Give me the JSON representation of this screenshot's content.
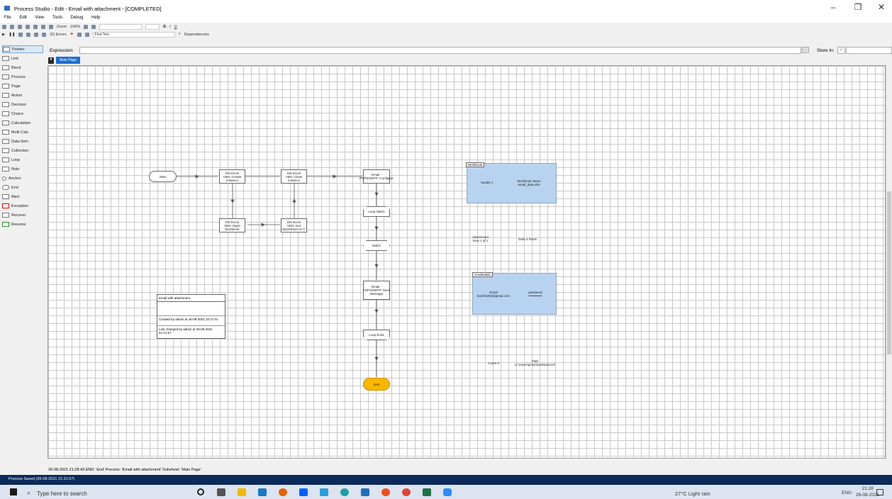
{
  "window": {
    "title": "Process Studio - Edit - Email with attachment - [COMPLETED]"
  },
  "menu": [
    "File",
    "Edit",
    "View",
    "Tools",
    "Debug",
    "Help"
  ],
  "toolbar1": {
    "zoom_label": "Zoom",
    "zoom_value": "100%"
  },
  "toolbar2": {
    "errors": "(0) Errors",
    "find_text": "Find Text",
    "dependencies": "Dependencies"
  },
  "expression": {
    "label": "Expression:",
    "store_in_label": "Store In:"
  },
  "tabs": {
    "main": "Main Page"
  },
  "tools": [
    "Pointer",
    "Link",
    "Block",
    "Process",
    "Page",
    "Action",
    "Decision",
    "Choice",
    "Calculation",
    "Multi Calc",
    "Data Item",
    "Collection",
    "Loop",
    "Note",
    "Anchor",
    "End",
    "Alert",
    "Exception",
    "Recover",
    "Resume"
  ],
  "flow": {
    "start": "Start",
    "create": "MS Excel VBO::Create Instance",
    "open": "MS Excel VBO::Open Workbook",
    "get": "MS Excel VBO::Get Worksheet As C",
    "close": "MS Excel VBO::Close Instance",
    "config": "Email - POP3/SMTP::Configure",
    "loop_start": "Loop Start1",
    "multi": "Multi1",
    "send": "Email - POP3/SMTP::Send Message",
    "loop_end": "Loop End1",
    "end": "End"
  },
  "info": {
    "title": "Email with attachment",
    "created": "Created by admin at 26-08-2021 10:27:01",
    "changed": "Last changed by admin at 26-08-2021 21:21:57"
  },
  "data": {
    "workbook_group": "Workbook",
    "handle": "handle 1",
    "wbname": "Workbook Name email_data.xlsx",
    "attachment": "Attachment Row 1 of 1",
    "dataitem": "Data 4 Rows",
    "cred_group": "Credentials",
    "email": "Email learnfs300@gmail.com",
    "password": "password ••••••••••••",
    "count": "Count 3",
    "path": "Path C:\\Users\\pinky\\Desktop\\cert\\"
  },
  "status": {
    "message": "26-08-2021 21:28:43 END: 'End' Process: 'Email with attachment' Subsheet: 'Main Page'",
    "saved": "Process Saved (26-08-2021 21:21:57)"
  },
  "taskbar": {
    "search": "Type here to search",
    "weather": "27°C  Light rain",
    "lang": "ENG",
    "time": "21:28",
    "date": "26-08-2021"
  },
  "colors": {
    "end_fill": "#f9b700",
    "group_fill": "#b8d3f0",
    "saved_bar": "#0c2a5a",
    "tab_active": "#1c6fd1"
  }
}
